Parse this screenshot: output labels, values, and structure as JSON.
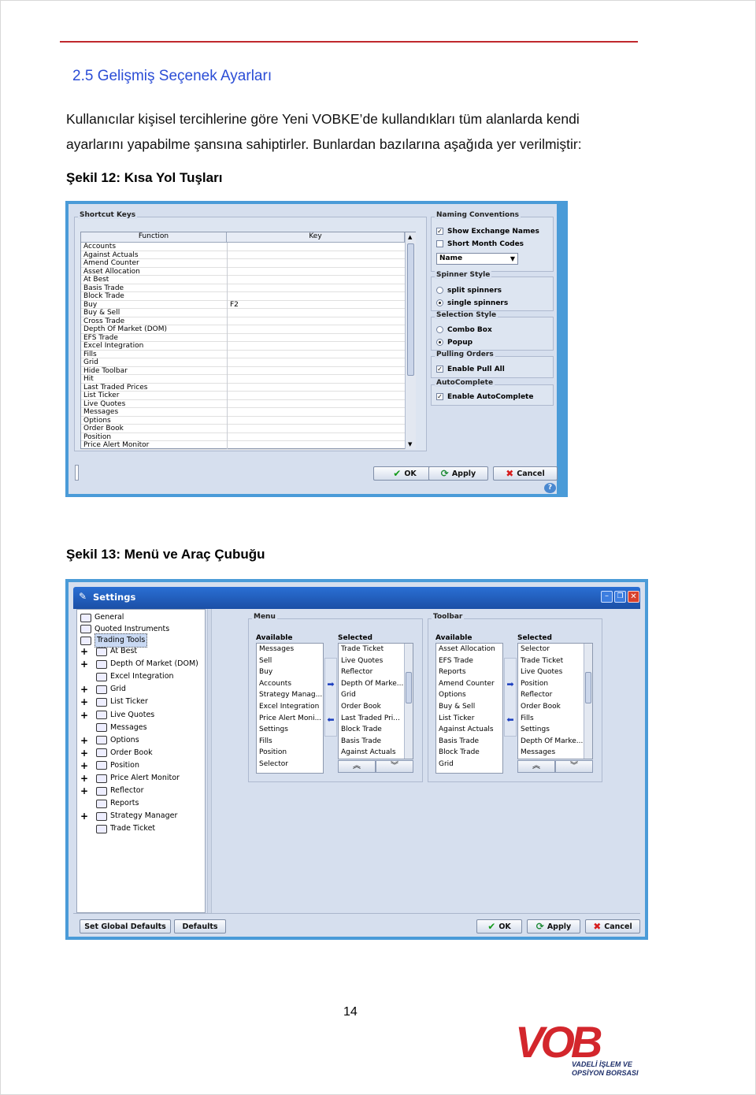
{
  "doc": {
    "heading": "2.5 Gelişmiş Seçenek Ayarları",
    "para_line1": "Kullanıcılar kişisel tercihlerine göre Yeni VOBKE’de kullandıkları tüm alanlarda kendi",
    "para_line2": "ayarlarını yapabilme şansına sahiptirler. Bunlardan bazılarına aşağıda yer verilmiştir:",
    "caption1": "Şekil 12: Kısa Yol Tuşları",
    "caption2": "Şekil 13: Menü ve Araç Çubuğu",
    "page_number": "14"
  },
  "fig12": {
    "shortcut_title": "Shortcut Keys",
    "col_function": "Function",
    "col_key": "Key",
    "rows": [
      {
        "function": "Accounts",
        "key": ""
      },
      {
        "function": "Against Actuals",
        "key": ""
      },
      {
        "function": "Amend Counter",
        "key": ""
      },
      {
        "function": "Asset Allocation",
        "key": ""
      },
      {
        "function": "At Best",
        "key": ""
      },
      {
        "function": "Basis Trade",
        "key": ""
      },
      {
        "function": "Block Trade",
        "key": ""
      },
      {
        "function": "Buy",
        "key": "F2"
      },
      {
        "function": "Buy & Sell",
        "key": ""
      },
      {
        "function": "Cross Trade",
        "key": ""
      },
      {
        "function": "Depth Of Market (DOM)",
        "key": ""
      },
      {
        "function": "EFS Trade",
        "key": ""
      },
      {
        "function": "Excel Integration",
        "key": ""
      },
      {
        "function": "Fills",
        "key": ""
      },
      {
        "function": "Grid",
        "key": ""
      },
      {
        "function": "Hide Toolbar",
        "key": ""
      },
      {
        "function": "Hit",
        "key": ""
      },
      {
        "function": "Last Traded Prices",
        "key": ""
      },
      {
        "function": "List Ticker",
        "key": ""
      },
      {
        "function": "Live Quotes",
        "key": ""
      },
      {
        "function": "Messages",
        "key": ""
      },
      {
        "function": "Options",
        "key": ""
      },
      {
        "function": "Order Book",
        "key": ""
      },
      {
        "function": "Position",
        "key": ""
      },
      {
        "function": "Price Alert Monitor",
        "key": ""
      }
    ],
    "naming_title": "Naming Conventions",
    "show_exchange_names": "Show Exchange Names",
    "show_exchange_checked": true,
    "short_month_codes": "Short Month Codes",
    "short_month_checked": false,
    "name_select": "Name",
    "spinner_title": "Spinner Style",
    "split_spinners": "split spinners",
    "single_spinners": "single spinners",
    "selection_title": "Selection Style",
    "combo_box": "Combo Box",
    "popup": "Popup",
    "pulling_title": "Pulling Orders",
    "enable_pull_all": "Enable Pull All",
    "autocomplete_title": "AutoComplete",
    "enable_autocomplete": "Enable AutoComplete",
    "ok": "OK",
    "apply": "Apply",
    "cancel": "Cancel"
  },
  "fig13": {
    "window_title": "Settings",
    "tree_top": [
      "General",
      "Quoted Instruments",
      "Trading Tools"
    ],
    "tree_items": [
      {
        "label": "At Best",
        "plus": true
      },
      {
        "label": "Depth Of Market (DOM)",
        "plus": true
      },
      {
        "label": "Excel Integration",
        "plus": false
      },
      {
        "label": "Grid",
        "plus": true
      },
      {
        "label": "List Ticker",
        "plus": true
      },
      {
        "label": "Live Quotes",
        "plus": true
      },
      {
        "label": "Messages",
        "plus": false
      },
      {
        "label": "Options",
        "plus": true
      },
      {
        "label": "Order Book",
        "plus": true
      },
      {
        "label": "Position",
        "plus": true
      },
      {
        "label": "Price Alert Monitor",
        "plus": true
      },
      {
        "label": "Reflector",
        "plus": true
      },
      {
        "label": "Reports",
        "plus": false
      },
      {
        "label": "Strategy Manager",
        "plus": true
      },
      {
        "label": "Trade Ticket",
        "plus": false
      }
    ],
    "menu_title": "Menu",
    "toolbar_title": "Toolbar",
    "available_label": "Available",
    "selected_label": "Selected",
    "menu_available": [
      "Messages",
      "Sell",
      "Buy",
      "Accounts",
      "Strategy Manag...",
      "Excel Integration",
      "Price Alert Moni...",
      "Settings",
      "Fills",
      "Position",
      "Selector"
    ],
    "menu_selected": [
      "Trade Ticket",
      "Live Quotes",
      "Reflector",
      "Depth Of Marke...",
      "Grid",
      "Order Book",
      "Last Traded Pri...",
      "Block Trade",
      "Basis Trade",
      "Against Actuals"
    ],
    "toolbar_available": [
      "Asset Allocation",
      "EFS Trade",
      "Reports",
      "Amend Counter",
      "Options",
      "Buy & Sell",
      "List Ticker",
      "Against Actuals",
      "Basis Trade",
      "Block Trade",
      "Grid"
    ],
    "toolbar_selected": [
      "Selector",
      "Trade Ticket",
      "Live Quotes",
      "Position",
      "Reflector",
      "Order Book",
      "Fills",
      "Settings",
      "Depth Of Marke...",
      "Messages"
    ],
    "set_global_defaults": "Set Global Defaults",
    "defaults": "Defaults",
    "ok": "OK",
    "apply": "Apply",
    "cancel": "Cancel"
  },
  "logo": {
    "brand": "VOB",
    "line1": "VADELİ İŞLEM VE",
    "line2": "OPSİYON BORSASI",
    "brand_color": "#d3262c"
  }
}
